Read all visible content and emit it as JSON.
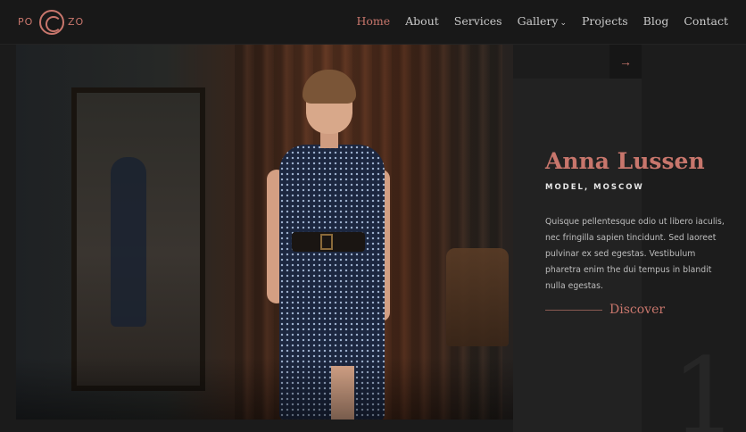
{
  "logo": {
    "left": "PO",
    "right": "ZO"
  },
  "nav": {
    "items": [
      {
        "label": "Home",
        "active": true
      },
      {
        "label": "About"
      },
      {
        "label": "Services"
      },
      {
        "label": "Gallery",
        "has_dropdown": true
      },
      {
        "label": "Projects"
      },
      {
        "label": "Blog"
      },
      {
        "label": "Contact"
      }
    ]
  },
  "hero": {
    "arrow_icon": "→",
    "name": "Anna Lussen",
    "role": "MODEL, MOSCOW",
    "description": "Quisque pellentesque odio ut libero iaculis, nec fringilla sapien tincidunt. Sed laoreet pulvinar ex sed egestas. Vestibulum pharetra enim the dui tempus in blandit nulla egestas.",
    "cta": "Discover",
    "slide_number": "1"
  },
  "colors": {
    "accent": "#c8766c",
    "background": "#1b1b1b",
    "panel": "#1c1c1c"
  }
}
